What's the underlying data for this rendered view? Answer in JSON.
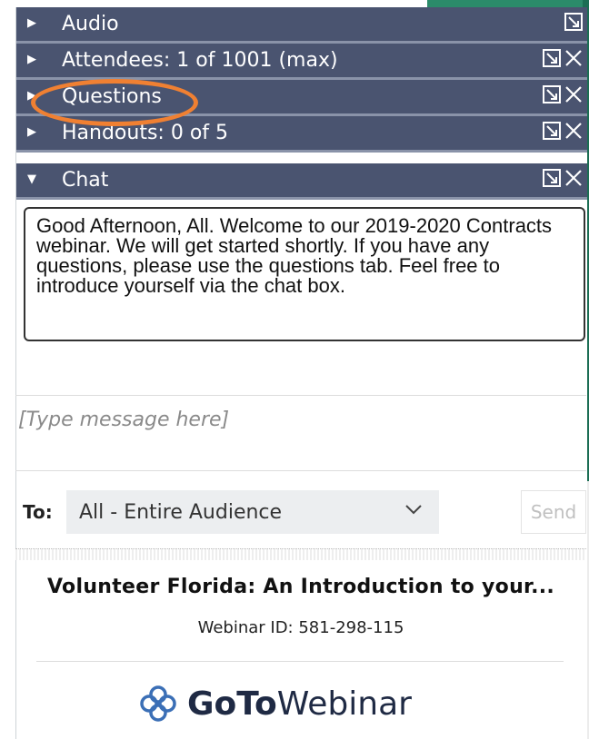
{
  "panels": [
    {
      "label": "Audio",
      "expanded": false,
      "closable": false
    },
    {
      "label": "Attendees: 1 of 1001 (max)",
      "expanded": false,
      "closable": true
    },
    {
      "label": "Questions",
      "expanded": false,
      "closable": true
    },
    {
      "label": "Handouts: 0 of 5",
      "expanded": false,
      "closable": true
    },
    {
      "label": "Chat",
      "expanded": true,
      "closable": true
    }
  ],
  "chat": {
    "message": "Good Afternoon, All. Welcome to our 2019-2020 Contracts webinar. We will get started shortly. If you have any questions, please use the questions tab. Feel free to introduce yourself via the chat box.",
    "input_placeholder": "[Type message here]",
    "to_label": "To:",
    "recipient": "All - Entire Audience",
    "send_label": "Send"
  },
  "webinar": {
    "title": "Volunteer Florida: An Introduction to your...",
    "id_text": "Webinar ID: 581-298-115"
  },
  "logo": {
    "bold": "GoTo",
    "rest": "Webinar"
  },
  "colors": {
    "header_bg": "#4a5470",
    "highlight": "#f08032",
    "accent_green": "#1c6e54"
  }
}
